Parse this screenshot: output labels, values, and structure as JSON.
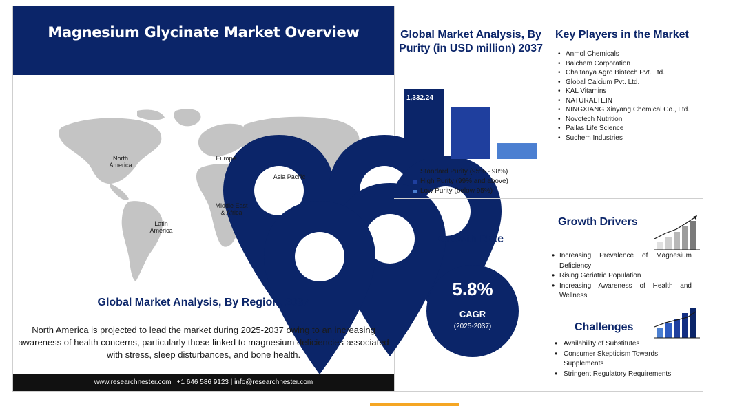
{
  "title": "Magnesium Glycinate Market Overview",
  "map": {
    "regions": [
      {
        "name": "North\nAmerica"
      },
      {
        "name": "Europe"
      },
      {
        "name": "Asia Pacific"
      },
      {
        "name": "Middle East\n& Africa"
      },
      {
        "name": "Latin\nAmerica"
      }
    ]
  },
  "region_heading": "Global Market Analysis, By Region, 2037",
  "region_text": "North America is projected to lead the market during 2025-2037 owing to an increasing awareness of health concerns, particularly those linked to magnesium deficiencies associated with stress, sleep disturbances, and bone health.",
  "footer": "www.researchnester.com  | +1 646 586 9123 | info@researchnester.com",
  "purity_heading": "Global Market Analysis, By Purity (in USD million) 2037",
  "chart_data": {
    "type": "bar",
    "categories": [
      "Standard Purity (95% - 98%)",
      "High Purity (99% and above)",
      "Low Purity (below 95%)"
    ],
    "values": [
      1332.24,
      980,
      300
    ],
    "data_labels": [
      "1,332.24",
      "",
      ""
    ],
    "colors": [
      "#0b2569",
      "#1f3f9e",
      "#4b7fd1"
    ],
    "legend_position": "bottom"
  },
  "players_heading": "Key Players in the Market",
  "players": [
    "Anmol Chemicals",
    "Balchem Corporation",
    "Chaitanya Agro Biotech Pvt. Ltd.",
    "Global Calcium Pvt. Ltd.",
    "KAL Vitamins",
    "NATURALTEIN",
    "NINGXIANG Xinyang Chemical Co., Ltd.",
    "Novotech Nutrition",
    "Pallas Life Science",
    "Suchem Industries"
  ],
  "growth": {
    "heading": "Growth Rate",
    "value": "5.8%",
    "label": "CAGR",
    "period": "(2025-2037)"
  },
  "drivers_heading": "Growth Drivers",
  "drivers": [
    "Increasing Prevalence of Magnesium Deficiency",
    "Rising Geriatric Population",
    "Increasing Awareness of Health and Wellness"
  ],
  "challenges_heading": "Challenges",
  "challenges": [
    "Availability of Substitutes",
    "Consumer Skepticism Towards Supplements",
    "Stringent Regulatory Requirements"
  ],
  "colors": {
    "brand_navy": "#0b2569",
    "map_gray": "#c4c4c4",
    "accent_orange": "#f5a623"
  },
  "icons": [
    "location-pin-icon",
    "bar-growth-icon",
    "bar-challenge-icon"
  ]
}
